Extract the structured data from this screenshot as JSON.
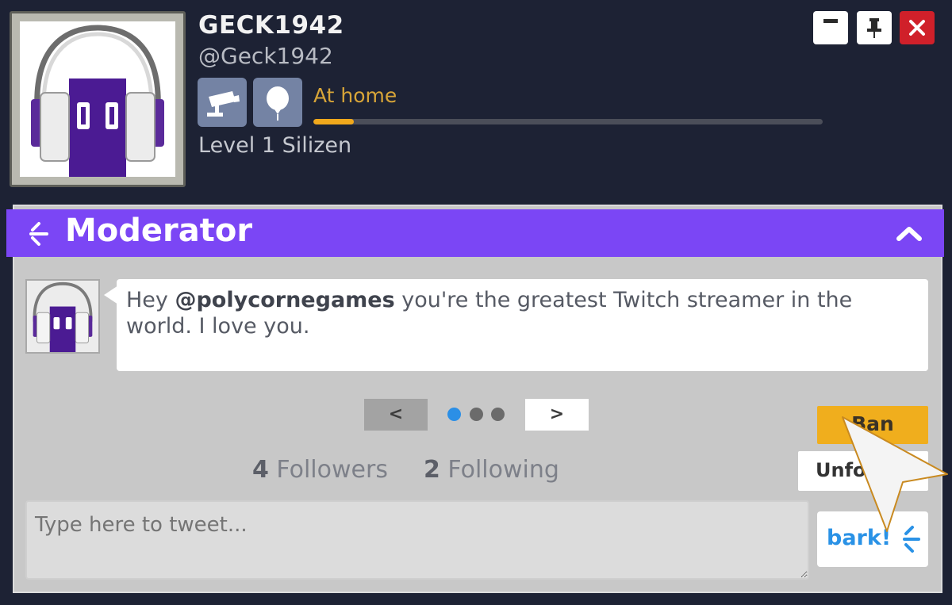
{
  "profile": {
    "username": "GECK1942",
    "handle": "@Geck1942",
    "status": "At home",
    "status_progress": 0.08,
    "level": "Level 1 Silizen",
    "badges": [
      "camera-icon",
      "balloon-icon"
    ]
  },
  "window_controls": [
    "minimize-icon",
    "pin-icon",
    "close-icon"
  ],
  "panel": {
    "title": "Moderator",
    "collapse_icon": "chevron-up-icon"
  },
  "tweet": {
    "text_prefix": "Hey ",
    "mention": "@polycornegames",
    "text_suffix": " you're the greatest Twitch streamer in the world. I love you."
  },
  "pager": {
    "prev_label": "<",
    "next_label": ">",
    "dots": 3,
    "active_index": 0
  },
  "actions": {
    "ban_label": "Ban",
    "unfollow_label": "Unfollow"
  },
  "stats": {
    "followers_count": "4",
    "followers_label": "Followers",
    "following_count": "2",
    "following_label": "Following"
  },
  "composer": {
    "placeholder": "Type here to tweet...",
    "submit_label": "bark!"
  },
  "colors": {
    "background": "#1d2234",
    "accent_purple": "#7b46f5",
    "status_orange": "#d8a538",
    "progress_fill": "#f0a81c",
    "ban_yellow": "#f0ae1d",
    "bark_blue": "#2a92e6",
    "close_red": "#d0202a"
  }
}
